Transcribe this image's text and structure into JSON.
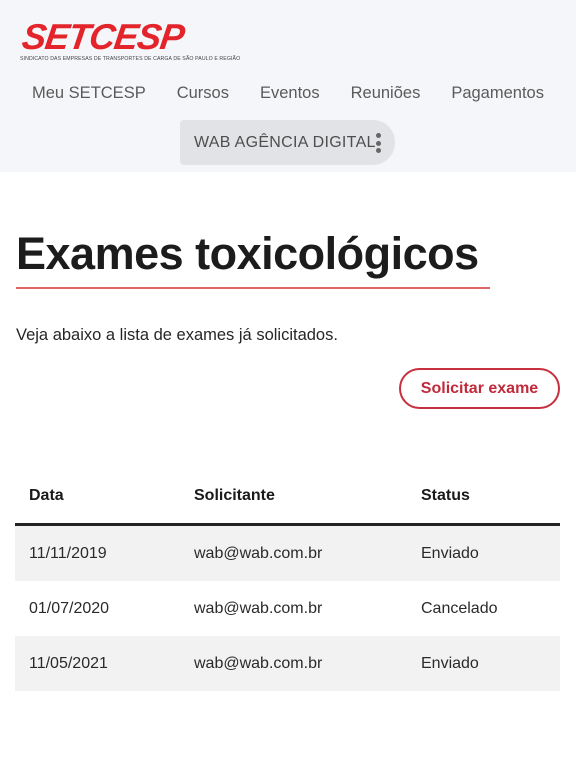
{
  "header": {
    "logo": {
      "wordmark": "SETCESP",
      "tagline": "SINDICATO DAS EMPRESAS DE TRANSPORTES DE CARGA DE SÃO PAULO E REGIÃO"
    },
    "nav": [
      {
        "label": "Meu SETCESP"
      },
      {
        "label": "Cursos"
      },
      {
        "label": "Eventos"
      },
      {
        "label": "Reuniões"
      },
      {
        "label": "Pagamentos"
      }
    ],
    "account": {
      "name": "WAB AGÊNCIA DIGITAL",
      "menu_icon": "kebab-vertical-icon"
    }
  },
  "main": {
    "title": "Exames toxicológicos",
    "intro": "Veja abaixo a lista de exames já solicitados.",
    "request_button": "Solicitar exame",
    "table": {
      "columns": [
        "Data",
        "Solicitante",
        "Status"
      ],
      "rows": [
        [
          "11/11/2019",
          "wab@wab.com.br",
          "Enviado"
        ],
        [
          "01/07/2020",
          "wab@wab.com.br",
          "Cancelado"
        ],
        [
          "11/05/2021",
          "wab@wab.com.br",
          "Enviado"
        ]
      ]
    }
  },
  "colors": {
    "brand_red": "#e3242b",
    "button_border": "#c8303f",
    "title_rule": "#e06565",
    "header_bg": "#f5f6f9",
    "account_bg": "#e2e3e6",
    "row_shade": "#f2f2f3"
  }
}
